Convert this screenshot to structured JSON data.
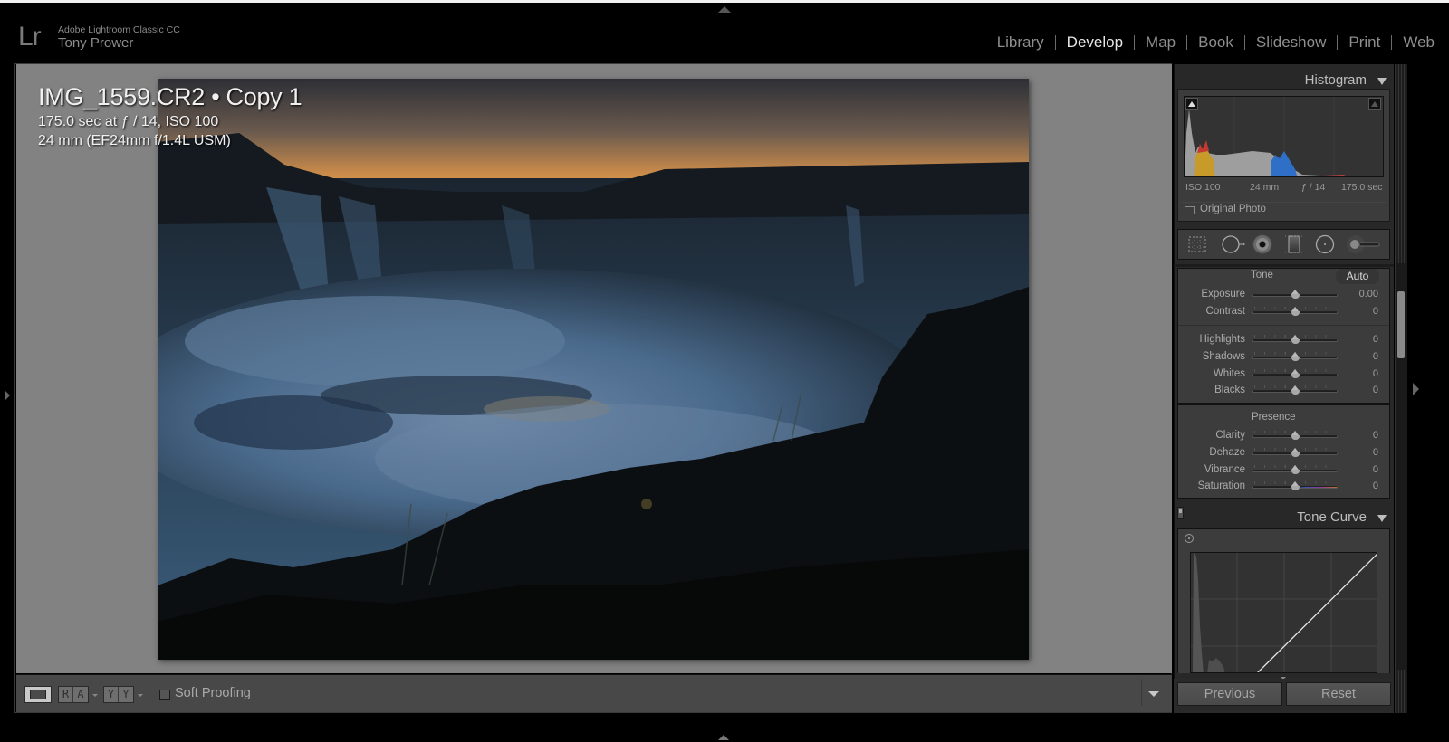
{
  "identity": {
    "logo": "Lr",
    "app_name": "Adobe Lightroom Classic CC",
    "user_name": "Tony Prower"
  },
  "modules": [
    {
      "label": "Library",
      "active": false
    },
    {
      "label": "Develop",
      "active": true
    },
    {
      "label": "Map",
      "active": false
    },
    {
      "label": "Book",
      "active": false
    },
    {
      "label": "Slideshow",
      "active": false
    },
    {
      "label": "Print",
      "active": false
    },
    {
      "label": "Web",
      "active": false
    }
  ],
  "photo_info": {
    "title": "IMG_1559.CR2 • Copy 1",
    "exposure_line": "175.0 sec at ƒ / 14, ISO 100",
    "lens_line": "24 mm (EF24mm f/1.4L USM)"
  },
  "toolbar": {
    "loupe_icon": "loupe-view-icon",
    "before_after_lr": [
      "R",
      "A"
    ],
    "before_after_tb": [
      "Y",
      "Y"
    ],
    "soft_proofing_label": "Soft Proofing",
    "soft_proofing_checked": false
  },
  "histogram": {
    "title": "Histogram",
    "iso": "ISO 100",
    "focal": "24 mm",
    "aperture": "ƒ / 14",
    "shutter": "175.0 sec",
    "original_photo_label": "Original Photo",
    "shadow_clip_on": true,
    "highlight_clip_on": false
  },
  "tools": [
    {
      "name": "crop-overlay-icon"
    },
    {
      "name": "spot-removal-icon"
    },
    {
      "name": "red-eye-icon"
    },
    {
      "name": "graduated-filter-icon"
    },
    {
      "name": "radial-filter-icon"
    },
    {
      "name": "adjustment-brush-icon"
    }
  ],
  "basic": {
    "tone_title": "Tone",
    "auto_label": "Auto",
    "presence_title": "Presence",
    "tone_sliders": [
      {
        "label": "Exposure",
        "value": "0.00",
        "position": 0.5
      },
      {
        "label": "Contrast",
        "value": "0",
        "position": 0.5
      }
    ],
    "tone_sliders2": [
      {
        "label": "Highlights",
        "value": "0",
        "position": 0.5
      },
      {
        "label": "Shadows",
        "value": "0",
        "position": 0.5
      },
      {
        "label": "Whites",
        "value": "0",
        "position": 0.5
      },
      {
        "label": "Blacks",
        "value": "0",
        "position": 0.5
      }
    ],
    "presence_sliders": [
      {
        "label": "Clarity",
        "value": "0",
        "position": 0.5,
        "colored": false
      },
      {
        "label": "Dehaze",
        "value": "0",
        "position": 0.5,
        "colored": false
      },
      {
        "label": "Vibrance",
        "value": "0",
        "position": 0.5,
        "colored": true
      },
      {
        "label": "Saturation",
        "value": "0",
        "position": 0.5,
        "colored": true
      }
    ]
  },
  "tone_curve": {
    "title": "Tone Curve"
  },
  "buttons": {
    "previous": "Previous",
    "reset": "Reset"
  },
  "colors": {
    "background": "#000000",
    "canvas": "#828282",
    "panel": "#3c3c3c",
    "active_module": "#e6e6e6",
    "inactive_module": "#8e8e8e"
  }
}
